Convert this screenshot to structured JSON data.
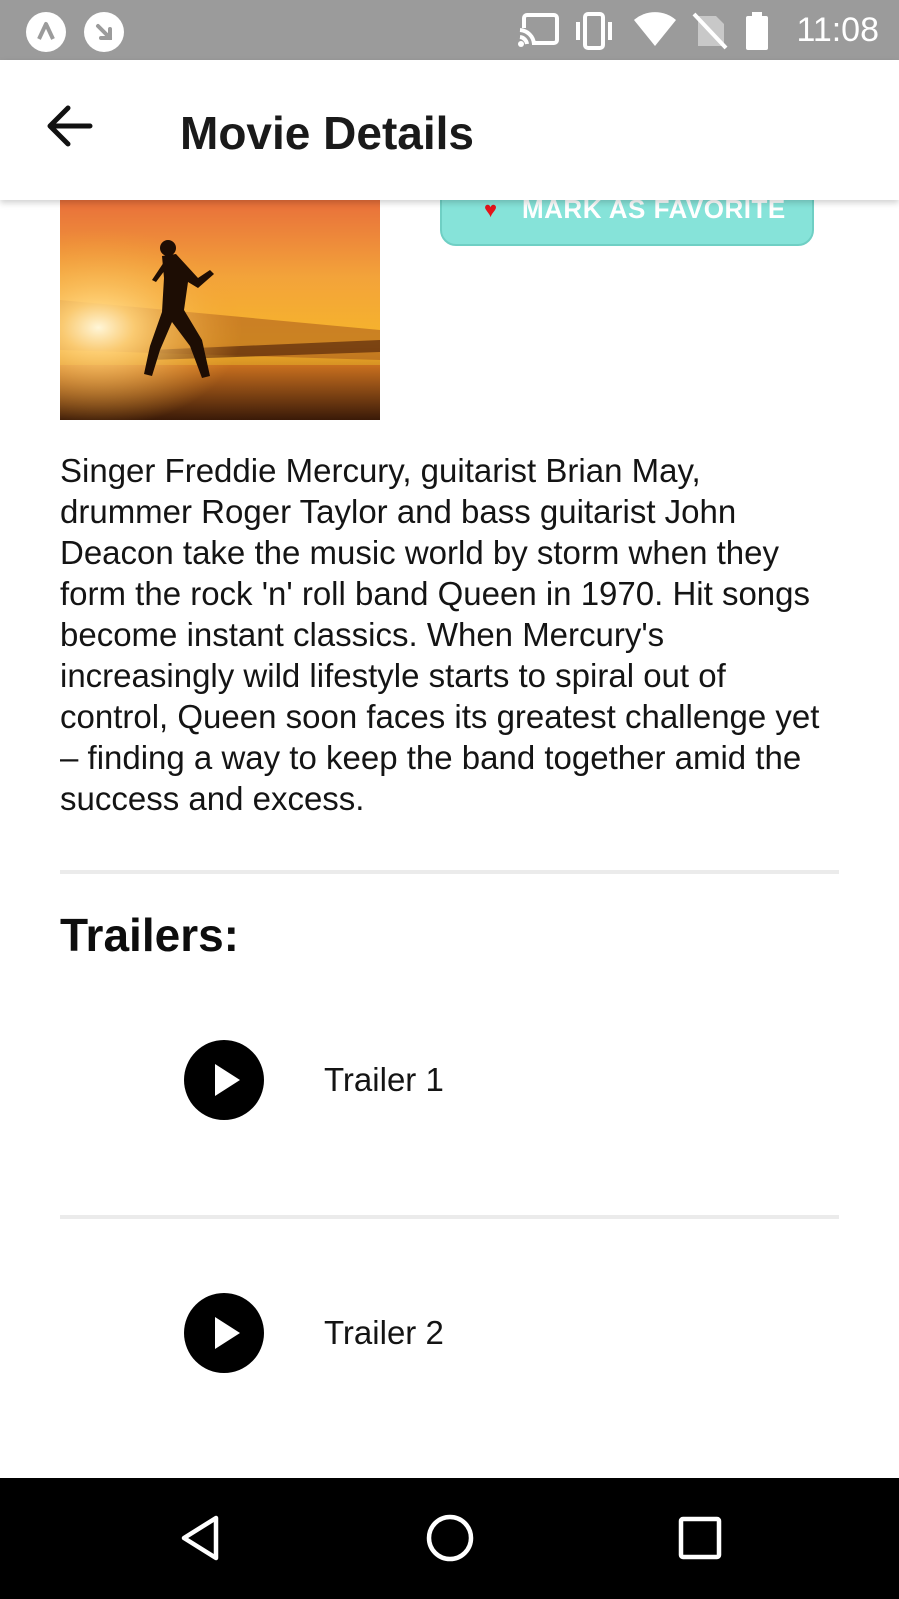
{
  "status_bar": {
    "time": "11:08",
    "icons": [
      "notification-app-icon",
      "notification-download-icon",
      "cast-icon",
      "vibrate-icon",
      "wifi-icon",
      "no-sim-icon",
      "battery-icon"
    ]
  },
  "app_bar": {
    "title": "Movie Details",
    "back_icon": "arrow-back-icon"
  },
  "movie": {
    "poster_alt": "Freddie Mercury on stage at sunset",
    "favorite_button_label": "MARK AS FAVORITE",
    "favorite_icon": "heart-icon",
    "overview": "Singer Freddie Mercury, guitarist Brian May, drummer Roger Taylor and bass guitarist John Deacon take the music world by storm when they form the rock 'n' roll band Queen in 1970. Hit songs become instant classics. When Mercury's increasingly wild lifestyle starts to spiral out of control, Queen soon faces its greatest challenge yet – finding a way to keep the band together amid the success and excess."
  },
  "trailers": {
    "heading": "Trailers:",
    "items": [
      {
        "label": "Trailer 1",
        "icon": "play-icon"
      },
      {
        "label": "Trailer 2",
        "icon": "play-icon"
      }
    ]
  },
  "nav_bar": {
    "buttons": [
      "back-triangle-icon",
      "home-circle-icon",
      "recents-square-icon"
    ]
  },
  "colors": {
    "favorite_button_bg": "#86e3d9",
    "heart": "#e4141a",
    "status_bar_bg": "#9b9b9b",
    "nav_bar_bg": "#000000"
  }
}
